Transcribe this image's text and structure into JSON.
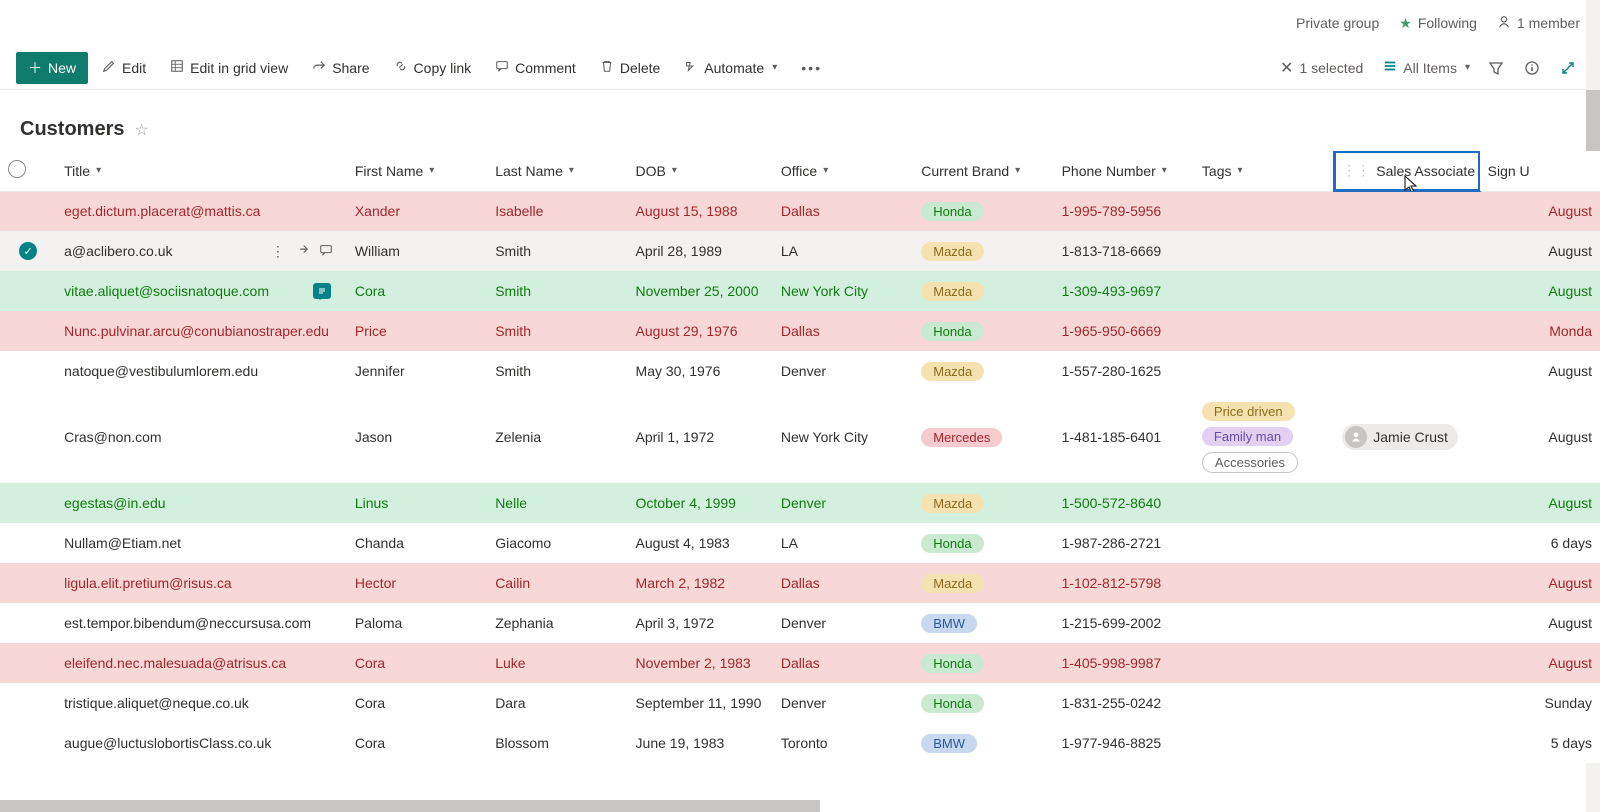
{
  "header": {
    "group_text": "Private group",
    "follow_text": "Following",
    "members_text": "1 member"
  },
  "cmd": {
    "new": "New",
    "edit": "Edit",
    "editgrid": "Edit in grid view",
    "share": "Share",
    "copylink": "Copy link",
    "comment": "Comment",
    "delete": "Delete",
    "automate": "Automate",
    "selected": "1 selected",
    "allitems": "All Items"
  },
  "list": {
    "title": "Customers"
  },
  "columns": {
    "title": "Title",
    "first": "First Name",
    "last": "Last Name",
    "dob": "DOB",
    "office": "Office",
    "brand": "Current Brand",
    "phone": "Phone Number",
    "tags": "Tags",
    "associate": "Sales Associate",
    "sign": "Sign U"
  },
  "rows": [
    {
      "style": "red",
      "title": "eget.dictum.placerat@mattis.ca",
      "first": "Xander",
      "last": "Isabelle",
      "dob": "August 15, 1988",
      "office": "Dallas",
      "brand": "Honda",
      "brandClass": "honda",
      "phone": "1-995-789-5956",
      "textClass": "txt-red",
      "sign": "August"
    },
    {
      "style": "sel",
      "selected": true,
      "title": "a@aclibero.co.uk",
      "first": "William",
      "last": "Smith",
      "dob": "April 28, 1989",
      "office": "LA",
      "brand": "Mazda",
      "brandClass": "mazda",
      "phone": "1-813-718-6669",
      "textClass": "txt-norm",
      "rowActions": true,
      "sign": "August"
    },
    {
      "style": "green",
      "title": "vitae.aliquet@sociisnatoque.com",
      "first": "Cora",
      "last": "Smith",
      "dob": "November 25, 2000",
      "office": "New York City",
      "brand": "Mazda",
      "brandClass": "mazda",
      "phone": "1-309-493-9697",
      "textClass": "txt-green",
      "commentBadge": true,
      "sign": "August"
    },
    {
      "style": "red",
      "title": "Nunc.pulvinar.arcu@conubianostraper.edu",
      "first": "Price",
      "last": "Smith",
      "dob": "August 29, 1976",
      "office": "Dallas",
      "brand": "Honda",
      "brandClass": "honda",
      "phone": "1-965-950-6669",
      "textClass": "txt-red",
      "sign": "Monda"
    },
    {
      "style": "white",
      "title": "natoque@vestibulumlorem.edu",
      "first": "Jennifer",
      "last": "Smith",
      "dob": "May 30, 1976",
      "office": "Denver",
      "brand": "Mazda",
      "brandClass": "mazda",
      "phone": "1-557-280-1625",
      "textClass": "txt-norm",
      "sign": "August"
    },
    {
      "style": "white",
      "tall": true,
      "title": "Cras@non.com",
      "first": "Jason",
      "last": "Zelenia",
      "dob": "April 1, 1972",
      "office": "New York City",
      "brand": "Mercedes",
      "brandClass": "mercedes",
      "phone": "1-481-185-6401",
      "textClass": "txt-norm",
      "tags": [
        "Price driven",
        "Family man",
        "Accessories"
      ],
      "tagClasses": [
        "tag-price",
        "tag-family",
        "tag-acc"
      ],
      "associate": "Jamie Crust",
      "sign": "August"
    },
    {
      "style": "green",
      "title": "egestas@in.edu",
      "first": "Linus",
      "last": "Nelle",
      "dob": "October 4, 1999",
      "office": "Denver",
      "brand": "Mazda",
      "brandClass": "mazda",
      "phone": "1-500-572-8640",
      "textClass": "txt-green",
      "sign": "August"
    },
    {
      "style": "white",
      "title": "Nullam@Etiam.net",
      "first": "Chanda",
      "last": "Giacomo",
      "dob": "August 4, 1983",
      "office": "LA",
      "brand": "Honda",
      "brandClass": "honda",
      "phone": "1-987-286-2721",
      "textClass": "txt-norm",
      "sign": "6 days"
    },
    {
      "style": "red",
      "title": "ligula.elit.pretium@risus.ca",
      "first": "Hector",
      "last": "Cailin",
      "dob": "March 2, 1982",
      "office": "Dallas",
      "brand": "Mazda",
      "brandClass": "mazda",
      "phone": "1-102-812-5798",
      "textClass": "txt-red",
      "sign": "August"
    },
    {
      "style": "white",
      "title": "est.tempor.bibendum@neccursusa.com",
      "first": "Paloma",
      "last": "Zephania",
      "dob": "April 3, 1972",
      "office": "Denver",
      "brand": "BMW",
      "brandClass": "bmw",
      "phone": "1-215-699-2002",
      "textClass": "txt-norm",
      "sign": "August"
    },
    {
      "style": "red",
      "title": "eleifend.nec.malesuada@atrisus.ca",
      "first": "Cora",
      "last": "Luke",
      "dob": "November 2, 1983",
      "office": "Dallas",
      "brand": "Honda",
      "brandClass": "honda",
      "phone": "1-405-998-9987",
      "textClass": "txt-red",
      "sign": "August"
    },
    {
      "style": "white",
      "title": "tristique.aliquet@neque.co.uk",
      "first": "Cora",
      "last": "Dara",
      "dob": "September 11, 1990",
      "office": "Denver",
      "brand": "Honda",
      "brandClass": "honda",
      "phone": "1-831-255-0242",
      "textClass": "txt-norm",
      "sign": "Sunday"
    },
    {
      "style": "white",
      "title": "augue@luctuslobortisClass.co.uk",
      "first": "Cora",
      "last": "Blossom",
      "dob": "June 19, 1983",
      "office": "Toronto",
      "brand": "BMW",
      "brandClass": "bmw",
      "phone": "1-977-946-8825",
      "textClass": "txt-norm",
      "sign": "5 days"
    }
  ]
}
